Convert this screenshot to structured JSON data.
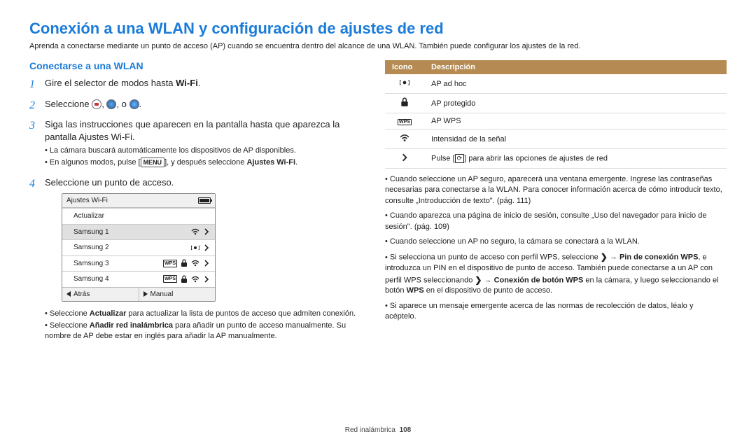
{
  "title": "Conexión a una WLAN y configuración de ajustes de red",
  "intro": "Aprenda a conectarse mediante un punto de acceso (AP) cuando se encuentra dentro del alcance de una WLAN. También puede configurar los ajustes de la red.",
  "section_title": "Conectarse a una WLAN",
  "steps": {
    "s1_a": "Gire el selector de modos hasta ",
    "s1_wifi": "Wi-Fi",
    "s1_b": ".",
    "s2_a": "Seleccione ",
    "s2_b": ", ",
    "s2_c": ", o ",
    "s2_d": ".",
    "s3": "Siga las instrucciones que aparecen en la pantalla hasta que aparezca la pantalla Ajustes Wi-Fi.",
    "s3_b1": "La cámara buscará automáticamente los dispositivos de AP disponibles.",
    "s3_b2_a": "En algunos modos, pulse [",
    "s3_b2_menu": "MENU",
    "s3_b2_b": "], y después seleccione ",
    "s3_b2_bold": "Ajustes Wi-Fi",
    "s3_b2_c": ".",
    "s4": "Seleccione un punto de acceso."
  },
  "wifi_panel": {
    "title": "Ajustes Wi-Fi",
    "refresh": "Actualizar",
    "rows": [
      {
        "name": "Samsung 1",
        "wps": false,
        "lock": false
      },
      {
        "name": "Samsung 2",
        "wps": false,
        "lock": false
      },
      {
        "name": "Samsung 3",
        "wps": true,
        "lock": true
      },
      {
        "name": "Samsung 4",
        "wps": true,
        "lock": true
      }
    ],
    "back": "Atrás",
    "manual": "Manual"
  },
  "below_bullets": {
    "b1_a": "Seleccione ",
    "b1_bold": "Actualizar",
    "b1_b": " para actualizar la lista de puntos de acceso que admiten conexión.",
    "b2_a": "Seleccione ",
    "b2_bold": "Añadir red inalámbrica",
    "b2_b": " para añadir un punto de acceso manualmente. Su nombre de AP debe estar en inglés para añadir la AP manualmente."
  },
  "table": {
    "h1": "Icono",
    "h2": "Descripción",
    "r1": "AP ad hoc",
    "r2": "AP protegido",
    "r3": "AP WPS",
    "r4": "Intensidad de la señal",
    "r5_a": "Pulse [",
    "r5_ref": "⟳",
    "r5_b": "] para abrir las opciones de ajustes de red"
  },
  "right_bullets": {
    "b1": "Cuando seleccione un AP seguro, aparecerá una ventana emergente. Ingrese las contraseñas necesarias para conectarse a la WLAN. Para conocer información acerca de cómo introducir texto, consulte „Introducción de texto\". (pág. 111)",
    "b2": "Cuando aparezca una página de inicio de sesión, consulte „Uso del navegador para inicio de sesión\". (pág. 109)",
    "b3": "Cuando seleccione un AP no seguro, la cámara se conectará a la WLAN.",
    "b4_a": "Si selecciona un punto de acceso con perfil WPS, seleccione ",
    "b4_b": " → ",
    "b4_bold1": "Pin de conexión WPS",
    "b4_c": ", e introduzca un PIN en el dispositivo de punto de acceso. También puede conectarse a un AP con perfil WPS seleccionando ",
    "b4_d": " → ",
    "b4_bold2": "Conexión de botón WPS",
    "b4_e": " en la cámara, y luego seleccionando el botón ",
    "b4_bold3": "WPS",
    "b4_f": " en el dispositivo de punto de acceso.",
    "b5": "Si aparece un mensaje emergente acerca de las normas de recolección de datos, léalo y acéptelo."
  },
  "footer_a": "Red inalámbrica",
  "footer_b": "108",
  "wps_label": "WPS"
}
